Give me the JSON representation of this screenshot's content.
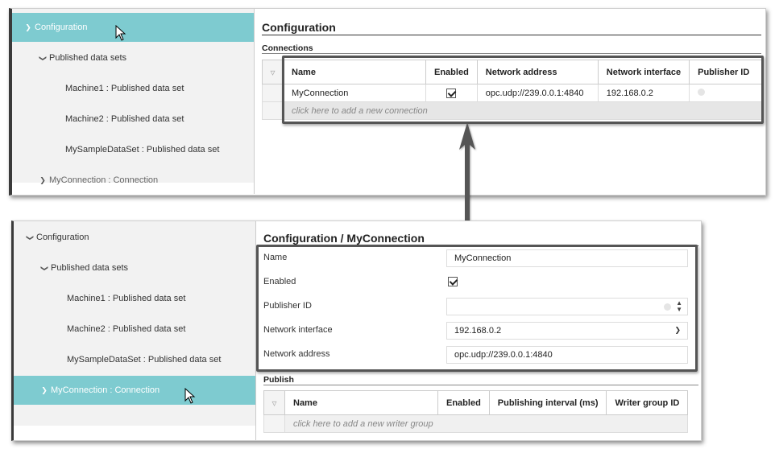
{
  "top": {
    "tree": [
      {
        "label": "Configuration",
        "selected": true
      },
      {
        "label": "Published data sets"
      },
      {
        "label": "Machine1 : Published data set"
      },
      {
        "label": "Machine2 : Published data set"
      },
      {
        "label": "MySampleDataSet : Published data set"
      },
      {
        "label": "MyConnection : Connection"
      }
    ],
    "title": "Configuration",
    "section": "Connections",
    "columns": [
      "Name",
      "Enabled",
      "Network address",
      "Network interface",
      "Publisher ID"
    ],
    "row": {
      "name": "MyConnection",
      "enabled": true,
      "network_address": "opc.udp://239.0.0.1:4840",
      "network_interface": "192.168.0.2"
    },
    "add_row": "click here to add a new connection"
  },
  "bottom": {
    "tree": [
      {
        "label": "Configuration"
      },
      {
        "label": "Published data sets"
      },
      {
        "label": "Machine1 : Published data set"
      },
      {
        "label": "Machine2 : Published data set"
      },
      {
        "label": "MySampleDataSet : Published data set"
      },
      {
        "label": "MyConnection : Connection",
        "selected": true
      }
    ],
    "title": "Configuration / MyConnection",
    "form": {
      "name_label": "Name",
      "name_value": "MyConnection",
      "enabled_label": "Enabled",
      "enabled": true,
      "publisher_id_label": "Publisher ID",
      "network_interface_label": "Network interface",
      "network_interface_value": "192.168.0.2",
      "network_address_label": "Network address",
      "network_address_value": "opc.udp://239.0.0.1:4840"
    },
    "section": "Publish",
    "columns": [
      "Name",
      "Enabled",
      "Publishing interval (ms)",
      "Writer group ID"
    ],
    "add_row": "click here to add a new writer group"
  },
  "colors": {
    "selected": "#7ecbd0",
    "tree_bg": "#f2f2f2",
    "highlight": "#555555"
  },
  "icons": [
    "chevron-down-icon",
    "chevron-right-icon",
    "mouse-cursor-icon",
    "filter-icon",
    "checkbox-checked-icon",
    "spinner-arrows-icon",
    "dropdown-arrow-icon",
    "double-arrow-icon"
  ]
}
